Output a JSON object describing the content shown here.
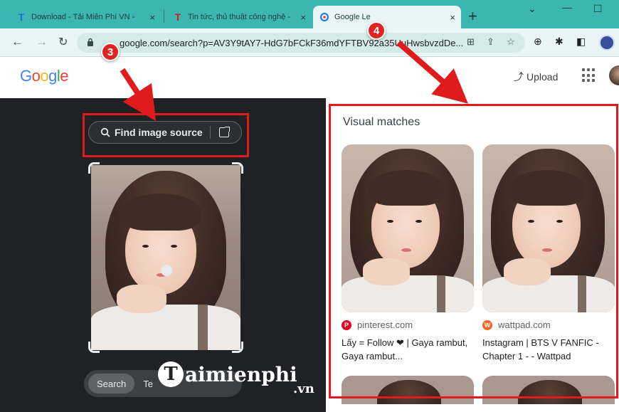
{
  "browser": {
    "tabs": [
      {
        "title": "Download - Tải Miễn Phí VN -",
        "favicon": "T",
        "favicon_color": "#1a6fe0"
      },
      {
        "title": "Tin tức, thủ thuật công nghệ -",
        "favicon": "T",
        "favicon_color": "#e01b1b"
      },
      {
        "title": "Google Le",
        "favicon": "google-lens-icon",
        "favicon_color": "#1a73e8"
      }
    ],
    "close_glyph": "×",
    "new_tab_glyph": "+",
    "url": "google.com/search?p=AV3Y9tAY7-HdG7bFCkF36mdYFTBV92a35UuHwsbvzdDe..."
  },
  "header": {
    "logo": [
      {
        "ch": "G",
        "color": "#4285f4"
      },
      {
        "ch": "o",
        "color": "#ea4335"
      },
      {
        "ch": "o",
        "color": "#fbbc05"
      },
      {
        "ch": "g",
        "color": "#4285f4"
      },
      {
        "ch": "l",
        "color": "#34a853"
      },
      {
        "ch": "e",
        "color": "#ea4335"
      }
    ],
    "upload_label": "Upload"
  },
  "lens": {
    "find_source_label": "Find image source",
    "modes": [
      "Search",
      "Te"
    ]
  },
  "watermark": {
    "initial": "T",
    "text": "aimienphi",
    "sub": ".vn"
  },
  "visual_matches": {
    "title": "Visual matches",
    "results": [
      {
        "source": "pinterest.com",
        "source_icon": "pinterest-icon",
        "icon_color": "#e60023",
        "icon_glyph": "P",
        "description": "Lấy = Follow ❤ | Gaya rambut, Gaya rambut..."
      },
      {
        "source": "wattpad.com",
        "source_icon": "wattpad-icon",
        "icon_color": "#ff6122",
        "icon_glyph": "W",
        "description": "Instagram | BTS V FANFIC - Chapter 1 - - Wattpad"
      }
    ]
  },
  "annotations": {
    "badge_3": "3",
    "badge_4": "4",
    "color": "#e01b1b"
  }
}
